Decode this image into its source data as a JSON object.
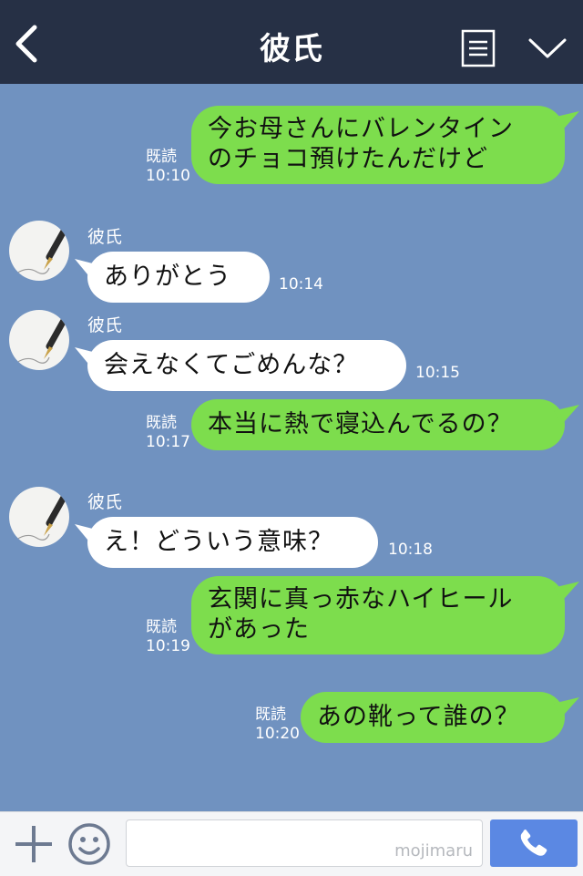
{
  "header": {
    "title": "彼氏"
  },
  "messages": [
    {
      "dir": "out",
      "lines": [
        "今お母さんにバレンタイン",
        "のチョコ預けたんだけど"
      ],
      "read": "既読",
      "time": "10:10"
    },
    {
      "dir": "in",
      "sender": "彼氏",
      "text": "ありがとう",
      "time": "10:14"
    },
    {
      "dir": "in",
      "sender": "彼氏",
      "text": "会えなくてごめんな？",
      "time": "10:15"
    },
    {
      "dir": "out",
      "text": "本当に熱で寝込んでるの？",
      "read": "既読",
      "time": "10:17"
    },
    {
      "dir": "in",
      "sender": "彼氏",
      "text": "え！どういう意味？",
      "time": "10:18"
    },
    {
      "dir": "out",
      "lines": [
        "玄関に真っ赤なハイヒール",
        "があった"
      ],
      "read": "既読",
      "time": "10:19"
    },
    {
      "dir": "out",
      "text": "あの靴って誰の？",
      "read": "既読",
      "time": "10:20"
    }
  ],
  "footer": {
    "input_value": "",
    "watermark": "mojimaru"
  },
  "colors": {
    "header_bg": "#263045",
    "chat_bg": "#7092c0",
    "outgoing_bubble": "#7ddd4d",
    "incoming_bubble": "#ffffff",
    "call_button": "#5b88e3"
  },
  "icons": {
    "back": "chevron-left-icon",
    "menu": "list-document-icon",
    "collapse": "chevron-down-icon",
    "add": "plus-icon",
    "emoji": "smiley-icon",
    "call": "phone-icon"
  }
}
